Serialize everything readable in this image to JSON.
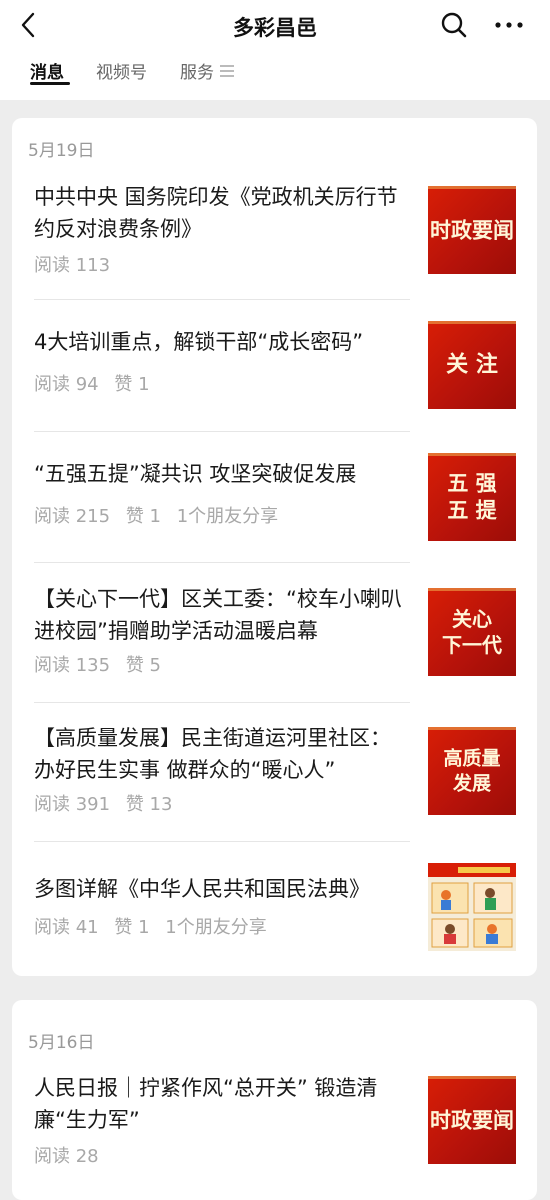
{
  "header": {
    "title": "多彩昌邑",
    "back_icon": "chevron-left-icon",
    "search_icon": "search-icon",
    "more_icon": "more-dots-icon"
  },
  "tabs": [
    {
      "label": "消息",
      "active": true
    },
    {
      "label": "视频号",
      "active": false
    },
    {
      "label": "服务",
      "active": false
    }
  ],
  "groups": [
    {
      "date": "5月19日",
      "articles": [
        {
          "title": "中共中央 国务院印发《党政机关厉行节约反对浪费条例》",
          "meta": [
            "阅读 113"
          ],
          "thumb": "时政要闻"
        },
        {
          "title": "4大培训重点，解锁干部“成长密码”",
          "meta": [
            "阅读 94",
            "赞 1"
          ],
          "thumb": "关 注"
        },
        {
          "title": "“五强五提”凝共识 攻坚突破促发展",
          "meta": [
            "阅读 215",
            "赞 1",
            "1个朋友分享"
          ],
          "thumb": "五 强\n五 提"
        },
        {
          "title": "【关心下一代】区关工委：“校车小喇叭进校园”捐赠助学活动温暖启幕",
          "meta": [
            "阅读 135",
            "赞 5"
          ],
          "thumb": "关心\n下一代"
        },
        {
          "title": "【高质量发展】民主街道运河里社区：办好民生实事 做群众的“暖心人”",
          "meta": [
            "阅读 391",
            "赞 13"
          ],
          "thumb": "高质量\n发展"
        },
        {
          "title": "多图详解《中华人民共和国民法典》",
          "meta": [
            "阅读 41",
            "赞 1",
            "1个朋友分享"
          ],
          "thumb": ""
        }
      ]
    },
    {
      "date": "5月16日",
      "articles": [
        {
          "title": "人民日报｜拧紧作风“总开关” 锻造清廉“生力军”",
          "meta": [
            "阅读 28"
          ],
          "thumb": "时政要闻"
        }
      ]
    }
  ],
  "colors": {
    "accent_red": "#c8160c",
    "background": "#ededed",
    "meta_grey": "#a8a8a8"
  }
}
